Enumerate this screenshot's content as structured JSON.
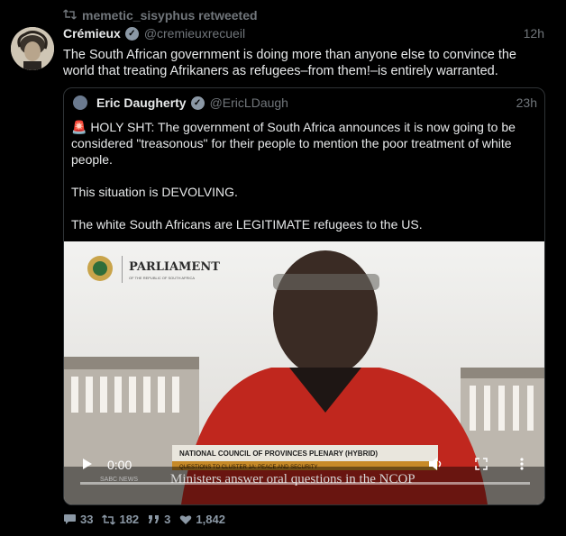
{
  "retweet": {
    "label": "memetic_sisyphus retweeted"
  },
  "tweet": {
    "author_name": "Crémieux",
    "author_handle": "@cremieuxrecueil",
    "time": "12h",
    "text": "The South African government is doing more than anyone else to convince the world that treating Afrikaners as refugees–from them!–is entirely warranted."
  },
  "quote": {
    "author_name": "Eric Daugherty",
    "author_handle": "@EricLDaugh",
    "time": "23h",
    "p1": "🚨 HOLY SHT: The government of South Africa announces it is now going to be considered \"treasonous\" for their people to mention the poor treatment of white people.",
    "p2": "This situation is DEVOLVING.",
    "p3": "The white South Africans are LEGITIMATE refugees to the US."
  },
  "video": {
    "logo_title": "PARLIAMENT",
    "logo_sub": "OF THE REPUBLIC OF SOUTH AFRICA",
    "banner_title": "NATIONAL COUNCIL OF PROVINCES PLENARY (HYBRID)",
    "banner_sub": "QUESTIONS TO CLUSTER 1A: PEACE AND SECURITY",
    "caption": "Ministers answer oral questions in the NCOP",
    "channel": "SABC NEWS",
    "current_time": "0:00"
  },
  "actions": {
    "replies": "33",
    "retweets": "182",
    "quotes": "3",
    "likes": "1,842"
  },
  "colors": {
    "background": "#000000",
    "text": "#e7e9ea",
    "muted": "#71767b",
    "border": "#2f3336"
  }
}
